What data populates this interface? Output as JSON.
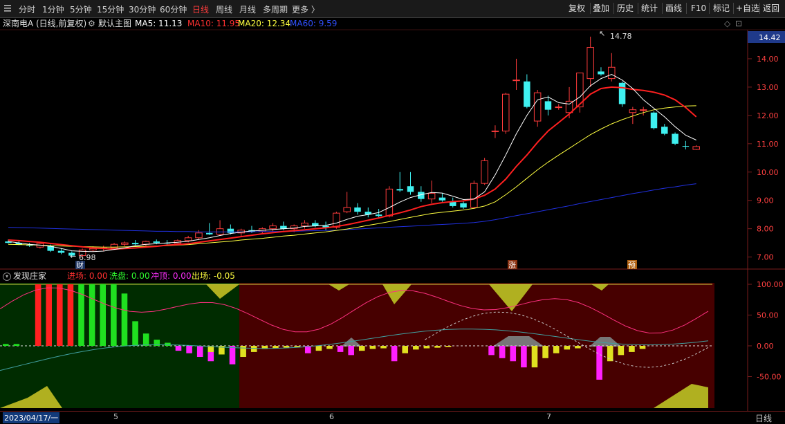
{
  "toolbar": {
    "periods": [
      "分时",
      "1分钟",
      "5分钟",
      "15分钟",
      "30分钟",
      "60分钟",
      "日线",
      "周线",
      "月线",
      "多周期",
      "更多 〉"
    ],
    "active_period": "日线",
    "right_buttons": [
      "复权",
      "叠加",
      "历史",
      "统计",
      "画线",
      "F10",
      "标记",
      "+自选",
      "返回"
    ]
  },
  "main_panel": {
    "stock_name": "深南电A",
    "mode": "(日线,前复权)",
    "template": "默认主图",
    "ma5_label": "MA5: 11.13",
    "ma10_label": "MA10: 11.95",
    "ma20_label": "MA20: 12.34",
    "ma60_label": "MA60: 9.59",
    "current_price_tag": "14.42",
    "high_marker": "14.78",
    "low_marker": "6.98",
    "event_marker_1": "财",
    "event_marker_2": "涨",
    "event_marker_3": "预"
  },
  "indicator_panel": {
    "name": "发现庄家",
    "entry_label": "进场: 0.00",
    "wash_label": "洗盘: 0.00",
    "top_label": "冲顶: 0.00",
    "exit_label": "出场: -0.05"
  },
  "footer": {
    "date_cursor": "2023/04/17/一",
    "month_5": "5",
    "month_6": "6",
    "month_7": "7",
    "period_label": "日线"
  },
  "colors": {
    "up": "#ff3c3c",
    "down": "#3ff0f0",
    "ma5": "#ffffff",
    "ma10": "#ff2020",
    "ma20": "#ffff40",
    "ma60": "#2030e0",
    "grid": "#7a1d1d"
  },
  "chart_data": [
    {
      "type": "candlestick",
      "title": "深南电A (日线,前复权)",
      "ylim": [
        6.6,
        15.0
      ],
      "y_ticks": [
        7.0,
        8.0,
        9.0,
        10.0,
        11.0,
        12.0,
        13.0,
        14.0
      ],
      "x_tick_labels": [
        "2023/04/17/一",
        "5",
        "6",
        "7"
      ],
      "ohlc": [
        [
          7.55,
          7.62,
          7.48,
          7.5
        ],
        [
          7.5,
          7.58,
          7.42,
          7.44
        ],
        [
          7.44,
          7.5,
          7.36,
          7.4
        ],
        [
          7.35,
          7.52,
          7.3,
          7.48
        ],
        [
          7.4,
          7.44,
          7.18,
          7.22
        ],
        [
          7.22,
          7.3,
          7.1,
          7.15
        ],
        [
          7.15,
          7.2,
          7.0,
          7.05
        ],
        [
          7.05,
          7.3,
          6.98,
          7.25
        ],
        [
          7.25,
          7.38,
          7.18,
          7.3
        ],
        [
          7.3,
          7.4,
          7.2,
          7.32
        ],
        [
          7.32,
          7.5,
          7.28,
          7.45
        ],
        [
          7.45,
          7.55,
          7.38,
          7.5
        ],
        [
          7.5,
          7.6,
          7.42,
          7.45
        ],
        [
          7.45,
          7.58,
          7.4,
          7.55
        ],
        [
          7.55,
          7.62,
          7.45,
          7.5
        ],
        [
          7.5,
          7.6,
          7.44,
          7.48
        ],
        [
          7.48,
          7.62,
          7.42,
          7.58
        ],
        [
          7.58,
          7.75,
          7.52,
          7.68
        ],
        [
          7.68,
          7.95,
          7.62,
          7.85
        ],
        [
          7.85,
          8.2,
          7.78,
          7.8
        ],
        [
          7.8,
          8.3,
          7.75,
          8.0
        ],
        [
          8.0,
          8.15,
          7.8,
          7.85
        ],
        [
          7.85,
          8.0,
          7.7,
          7.95
        ],
        [
          7.95,
          8.1,
          7.85,
          7.9
        ],
        [
          7.9,
          8.05,
          7.8,
          8.0
        ],
        [
          8.0,
          8.2,
          7.9,
          8.1
        ],
        [
          8.1,
          8.25,
          7.95,
          8.0
        ],
        [
          8.0,
          8.15,
          7.88,
          8.1
        ],
        [
          8.1,
          8.3,
          8.0,
          8.2
        ],
        [
          8.2,
          8.3,
          8.05,
          8.1
        ],
        [
          8.1,
          8.25,
          7.95,
          8.05
        ],
        [
          8.05,
          8.6,
          8.0,
          8.55
        ],
        [
          8.6,
          9.3,
          8.55,
          8.75
        ],
        [
          8.75,
          8.9,
          8.5,
          8.6
        ],
        [
          8.6,
          8.75,
          8.4,
          8.5
        ],
        [
          8.5,
          8.7,
          8.4,
          8.45
        ],
        [
          8.45,
          9.5,
          8.4,
          9.4
        ],
        [
          9.4,
          10.0,
          9.3,
          9.35
        ],
        [
          9.5,
          10.0,
          9.2,
          9.3
        ],
        [
          9.3,
          9.5,
          8.95,
          9.05
        ],
        [
          9.05,
          9.7,
          8.9,
          9.25
        ],
        [
          9.1,
          9.25,
          8.95,
          9.0
        ],
        [
          8.95,
          9.1,
          8.75,
          8.8
        ],
        [
          8.9,
          9.0,
          8.7,
          8.75
        ],
        [
          8.75,
          9.7,
          8.7,
          9.6
        ],
        [
          9.6,
          10.5,
          9.55,
          10.4
        ],
        [
          11.45,
          11.65,
          11.2,
          11.45
        ],
        [
          11.45,
          12.8,
          11.35,
          12.75
        ],
        [
          13.25,
          14.0,
          12.9,
          13.25
        ],
        [
          13.2,
          13.45,
          12.25,
          12.3
        ],
        [
          11.8,
          12.9,
          11.6,
          12.8
        ],
        [
          12.5,
          12.7,
          12.0,
          12.2
        ],
        [
          12.3,
          12.4,
          12.2,
          12.3
        ],
        [
          12.1,
          13.0,
          11.9,
          12.5
        ],
        [
          12.3,
          13.5,
          12.1,
          13.5
        ],
        [
          13.3,
          14.78,
          13.0,
          14.4
        ],
        [
          13.55,
          13.7,
          13.4,
          13.45
        ],
        [
          13.3,
          14.2,
          13.2,
          13.7
        ],
        [
          13.15,
          13.2,
          12.3,
          12.4
        ],
        [
          12.1,
          12.3,
          11.7,
          12.2
        ],
        [
          12.2,
          12.3,
          12.0,
          12.2
        ],
        [
          12.1,
          12.15,
          11.5,
          11.55
        ],
        [
          11.6,
          11.7,
          11.3,
          11.35
        ],
        [
          11.35,
          11.4,
          10.95,
          11.0
        ],
        [
          10.92,
          11.1,
          10.8,
          10.9
        ],
        [
          10.8,
          10.95,
          10.78,
          10.9
        ]
      ],
      "ma5": [
        7.55,
        7.5,
        7.45,
        7.42,
        7.38,
        7.3,
        7.22,
        7.2,
        7.19,
        7.21,
        7.27,
        7.32,
        7.4,
        7.45,
        7.47,
        7.5,
        7.52,
        7.56,
        7.62,
        7.68,
        7.76,
        7.83,
        7.88,
        7.92,
        7.94,
        7.97,
        8.0,
        8.02,
        8.08,
        8.1,
        8.12,
        8.2,
        8.33,
        8.44,
        8.5,
        8.57,
        8.75,
        8.94,
        9.1,
        9.2,
        9.28,
        9.26,
        9.15,
        9.03,
        9.05,
        9.3,
        9.9,
        10.6,
        11.35,
        12.0,
        12.55,
        12.65,
        12.45,
        12.4,
        12.65,
        13.05,
        13.3,
        13.45,
        13.25,
        12.95,
        12.55,
        12.25,
        11.95,
        11.6,
        11.3,
        11.13
      ],
      "ma10": [
        7.6,
        7.58,
        7.55,
        7.52,
        7.48,
        7.44,
        7.4,
        7.36,
        7.32,
        7.3,
        7.28,
        7.3,
        7.32,
        7.35,
        7.38,
        7.42,
        7.44,
        7.47,
        7.52,
        7.57,
        7.62,
        7.67,
        7.72,
        7.77,
        7.82,
        7.86,
        7.9,
        7.93,
        7.96,
        8.0,
        8.03,
        8.08,
        8.14,
        8.22,
        8.3,
        8.38,
        8.47,
        8.56,
        8.66,
        8.78,
        8.86,
        8.92,
        8.96,
        8.98,
        9.05,
        9.18,
        9.4,
        9.75,
        10.2,
        10.6,
        11.05,
        11.45,
        11.75,
        12.05,
        12.4,
        12.75,
        12.95,
        13.0,
        12.98,
        12.92,
        12.88,
        12.82,
        12.72,
        12.55,
        12.28,
        11.95
      ],
      "ma20": [
        7.45,
        7.44,
        7.43,
        7.42,
        7.4,
        7.39,
        7.38,
        7.37,
        7.36,
        7.35,
        7.35,
        7.36,
        7.37,
        7.38,
        7.39,
        7.4,
        7.42,
        7.44,
        7.47,
        7.5,
        7.53,
        7.56,
        7.6,
        7.63,
        7.66,
        7.7,
        7.74,
        7.77,
        7.81,
        7.85,
        7.89,
        7.94,
        7.99,
        8.05,
        8.12,
        8.18,
        8.25,
        8.33,
        8.4,
        8.47,
        8.54,
        8.58,
        8.62,
        8.66,
        8.72,
        8.8,
        8.95,
        9.2,
        9.48,
        9.78,
        10.08,
        10.35,
        10.6,
        10.84,
        11.08,
        11.32,
        11.52,
        11.7,
        11.85,
        11.98,
        12.1,
        12.2,
        12.26,
        12.3,
        12.33,
        12.34
      ],
      "ma60": [
        8.05,
        8.04,
        8.03,
        8.02,
        8.01,
        8.0,
        7.99,
        7.98,
        7.97,
        7.96,
        7.95,
        7.94,
        7.93,
        7.92,
        7.91,
        7.91,
        7.9,
        7.9,
        7.89,
        7.89,
        7.89,
        7.89,
        7.89,
        7.89,
        7.9,
        7.9,
        7.91,
        7.91,
        7.92,
        7.93,
        7.94,
        7.95,
        7.97,
        7.99,
        8.01,
        8.03,
        8.05,
        8.07,
        8.09,
        8.11,
        8.13,
        8.15,
        8.17,
        8.19,
        8.22,
        8.26,
        8.32,
        8.39,
        8.46,
        8.53,
        8.6,
        8.67,
        8.74,
        8.81,
        8.89,
        8.96,
        9.03,
        9.1,
        9.17,
        9.24,
        9.3,
        9.37,
        9.43,
        9.48,
        9.54,
        9.59
      ]
    },
    {
      "type": "bar",
      "title": "发现庄家",
      "ylim": [
        -100,
        100
      ],
      "y_ticks": [
        100.0,
        50.0,
        0.0,
        -50.0
      ],
      "series": [
        {
          "name": "进场",
          "values": [
            0,
            0,
            0,
            100,
            100,
            100,
            100,
            0,
            0,
            0,
            0,
            0,
            0,
            0,
            0,
            0,
            0,
            0,
            0,
            0,
            0,
            0,
            0,
            0,
            0,
            0,
            0,
            0,
            0,
            0,
            0,
            0,
            0,
            0,
            0,
            0,
            0,
            0,
            0,
            0,
            0,
            0,
            0,
            0,
            0,
            0,
            0,
            0,
            0,
            0,
            0,
            0,
            0,
            0,
            0,
            0,
            0,
            0,
            0,
            0,
            0,
            0,
            0,
            0,
            0,
            0
          ]
        },
        {
          "name": "洗盘",
          "values": [
            3,
            3,
            0,
            0,
            0,
            0,
            0,
            100,
            100,
            100,
            100,
            85,
            40,
            20,
            10,
            5,
            0,
            0,
            0,
            0,
            0,
            0,
            0,
            0,
            0,
            0,
            0,
            0,
            0,
            0,
            0,
            0,
            0,
            0,
            0,
            0,
            0,
            0,
            0,
            0,
            0,
            0,
            0,
            0,
            0,
            0,
            0,
            0,
            0,
            0,
            0,
            0,
            0,
            0,
            0,
            0,
            0,
            0,
            0,
            0,
            0,
            0,
            0,
            0,
            0,
            0
          ]
        },
        {
          "name": "冲顶",
          "values": [
            0,
            0,
            0,
            0,
            0,
            0,
            0,
            0,
            0,
            0,
            0,
            0,
            0,
            0,
            0,
            0,
            -8,
            -12,
            -18,
            -25,
            0,
            -30,
            0,
            0,
            0,
            0,
            0,
            0,
            -12,
            0,
            0,
            -10,
            -15,
            0,
            0,
            0,
            -25,
            0,
            0,
            0,
            0,
            0,
            0,
            0,
            0,
            -15,
            -20,
            -25,
            -35,
            0,
            0,
            0,
            0,
            0,
            0,
            -55,
            0,
            0,
            0,
            0,
            0,
            0,
            0,
            0,
            0,
            0
          ]
        },
        {
          "name": "出场",
          "values": [
            0,
            0,
            0,
            0,
            0,
            0,
            0,
            0,
            0,
            0,
            0,
            0,
            0,
            0,
            0,
            0,
            0,
            0,
            0,
            -10,
            -14,
            0,
            -18,
            -10,
            -5,
            -4,
            -3,
            -2,
            0,
            -8,
            -5,
            0,
            0,
            -8,
            -5,
            -4,
            0,
            -12,
            -6,
            -4,
            -3,
            -2,
            0,
            0,
            0,
            0,
            0,
            0,
            0,
            -35,
            -20,
            -12,
            -6,
            -4,
            0,
            0,
            -25,
            -15,
            -10,
            -5,
            0,
            0,
            0,
            0,
            0,
            0
          ]
        }
      ]
    }
  ]
}
